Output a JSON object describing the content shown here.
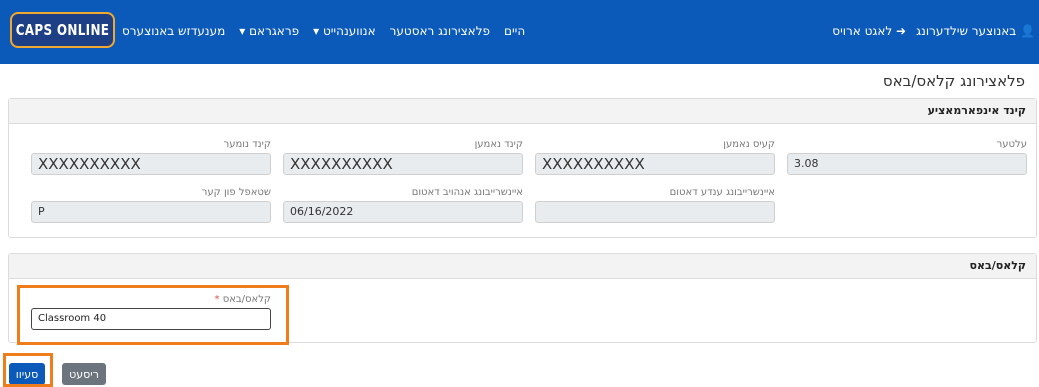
{
  "navbar": {
    "logo_text": "CAPS ONLINE",
    "links": [
      "היים",
      "פלאצירונג ראסטער",
      "אנווענהייט",
      "פראגראם",
      "מענעדזש באנוצערס"
    ],
    "user_menu_label": "באנוצער שילדערונג",
    "logout_label": "לאגט ארויס",
    "accent_color": "#0b5ab9"
  },
  "page": {
    "title": "פלאצירונג קלאס/באס"
  },
  "child_info": {
    "header": "קינד אינפארמאציע",
    "fields": [
      {
        "label": "קינד נומער",
        "value": "XXXXXXXXXX"
      },
      {
        "label": "קינד נאמען",
        "value": "XXXXXXXXXX"
      },
      {
        "label": "קעיס נאמען",
        "value": "XXXXXXXXXX"
      },
      {
        "label": "עלטער",
        "value": "3.08"
      },
      {
        "label": "שטאפל פון קער",
        "value": "P"
      },
      {
        "label": "איינשרייבונג אנהויב דאטום",
        "value": "06/16/2022"
      },
      {
        "label": "איינשרייבונג ענדע דאטום",
        "value": ""
      }
    ]
  },
  "classroom": {
    "header": "קלאס/באס",
    "field_label": "קלאס/באס",
    "required_mark": "*",
    "value": "Classroom 40"
  },
  "actions": {
    "save_label": "סעיוו",
    "reset_label": "ריסעט"
  },
  "colors": {
    "highlight": "#f07d1c",
    "save_button": "#0b5ab9",
    "reset_button": "#6c757d"
  }
}
